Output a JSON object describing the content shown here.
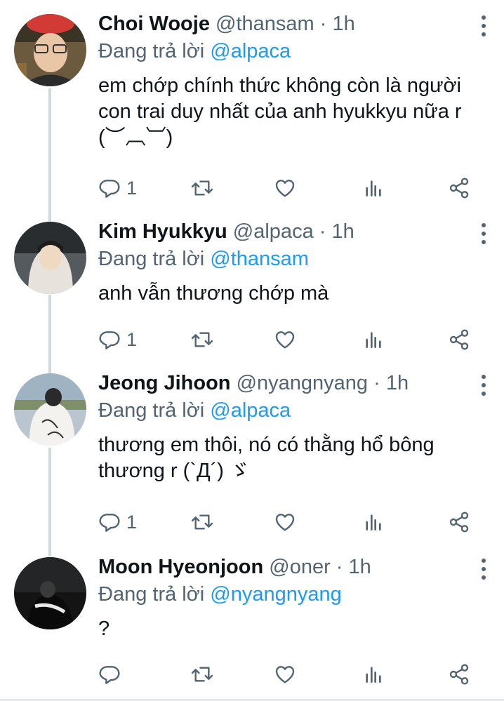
{
  "tweets": [
    {
      "name": "Choi Wooje",
      "handle": "@thansam",
      "dot": "·",
      "time": "1h",
      "reply_prefix": "Đang trả lời",
      "reply_to": "@alpaca",
      "text": "em chớp chính thức không còn là người con trai duy nhất của anh hyukkyu nữa r (︶︹︺)",
      "reply_count": "1",
      "avatar_icon": "avatar-photo"
    },
    {
      "name": "Kim Hyukkyu",
      "handle": "@alpaca",
      "dot": "·",
      "time": "1h",
      "reply_prefix": "Đang trả lời",
      "reply_to": "@thansam",
      "text": "anh vẫn thương chớp mà",
      "reply_count": "1",
      "avatar_icon": "avatar-photo"
    },
    {
      "name": "Jeong Jihoon",
      "handle": "@nyangnyang",
      "dot": "·",
      "time": "1h",
      "reply_prefix": "Đang trả lời",
      "reply_to": "@alpaca",
      "text": "thương em thôi, nó có thằng hổ bông thương r (`Д´) ゞ",
      "reply_count": "1",
      "avatar_icon": "avatar-photo"
    },
    {
      "name": "Moon Hyeonjoon",
      "handle": "@oner",
      "dot": "·",
      "time": "1h",
      "reply_prefix": "Đang trả lời",
      "reply_to": "@nyangnyang",
      "text": "?",
      "reply_count": "",
      "avatar_icon": "avatar-photo"
    }
  ],
  "icons": {
    "reply": "reply-icon",
    "retweet": "retweet-icon",
    "like": "heart-icon",
    "stats": "analytics-icon",
    "share": "share-icon",
    "more": "more-vertical-icon"
  },
  "colors": {
    "accent": "#1d9bf0",
    "secondary_text": "#536471",
    "thread_line": "#cfd9de"
  }
}
